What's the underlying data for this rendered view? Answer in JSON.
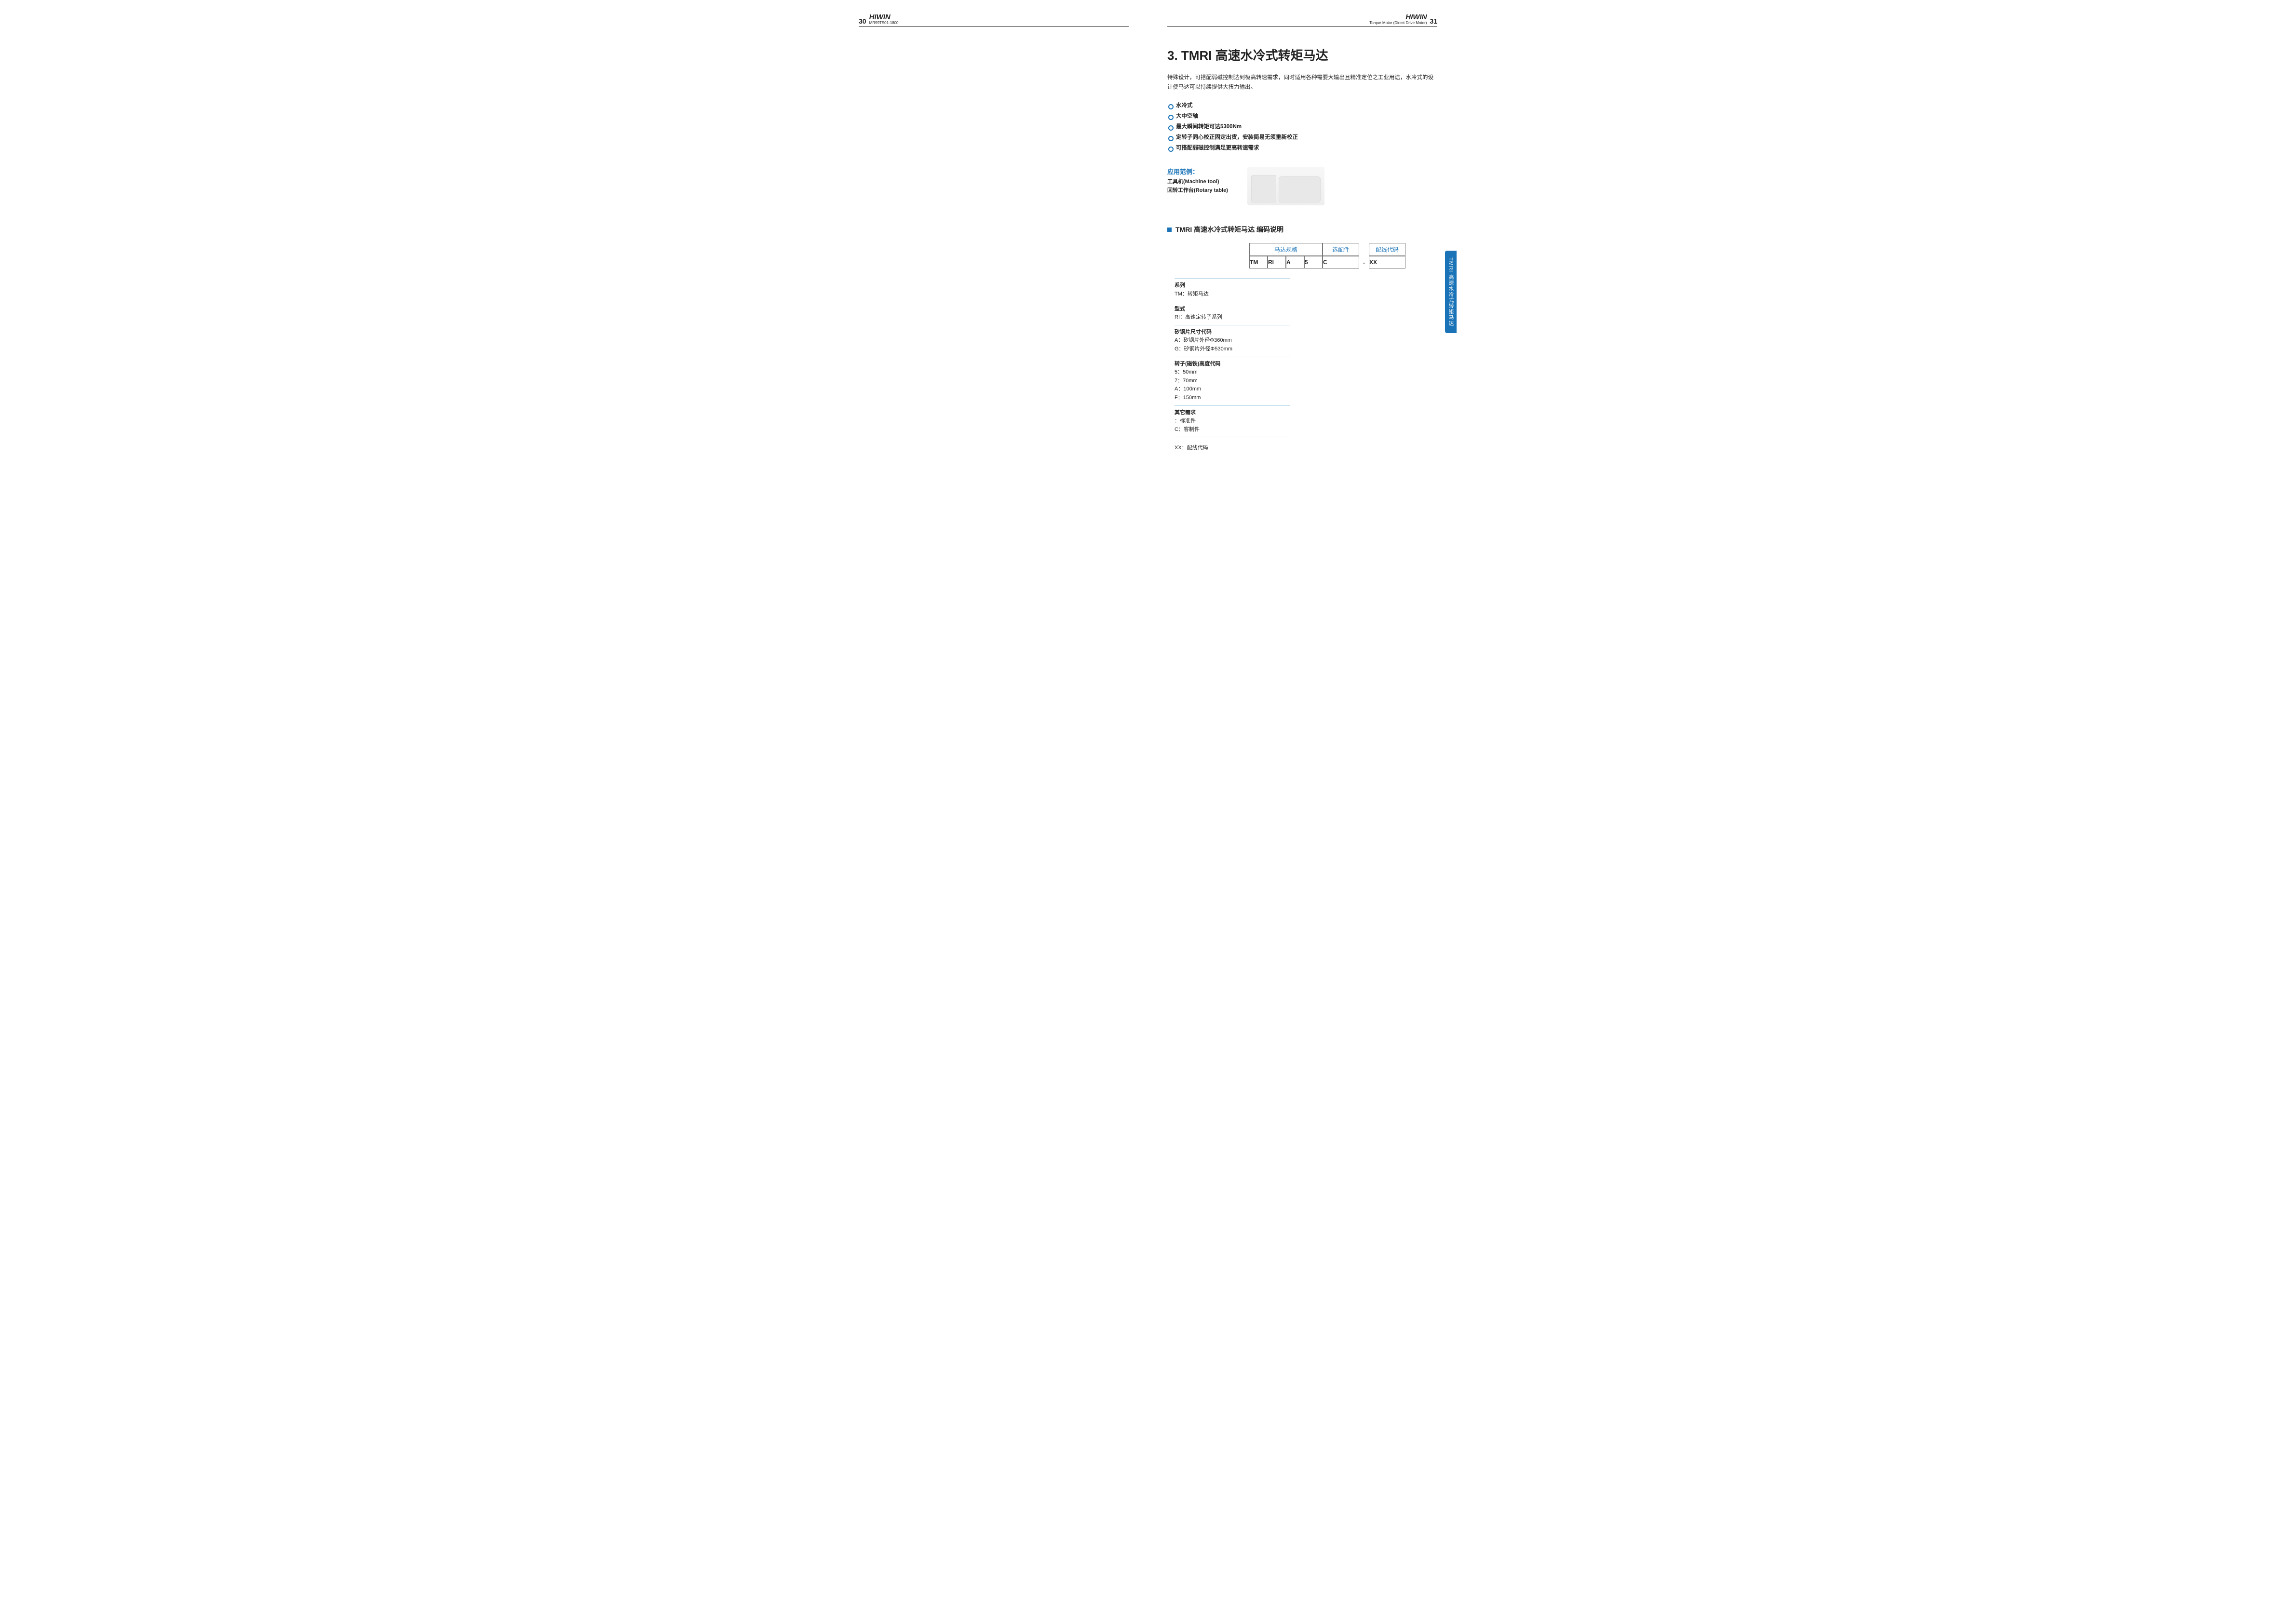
{
  "header": {
    "left": {
      "page": "30",
      "brand": "HIWIN",
      "doccode": "MR99TS01-1800"
    },
    "right": {
      "brand": "HIWIN",
      "subtitle": "Torque Motor (Direct Drive Motor)",
      "page": "31"
    }
  },
  "title": "3. TMRI 高速水冷式转矩马达",
  "intro": "特殊设计，可搭配弱磁控制达到极高转速需求，同时适用各种需要大输出且精准定位之工业用途，水冷式的设计使马达可以持续提供大扭力输出。",
  "features": [
    "水冷式",
    "大中空轴",
    "最大瞬间转矩可达5300Nm",
    "定转子同心校正固定出货，安装简易无须重新校正",
    "可搭配弱磁控制满足更高转速需求"
  ],
  "application": {
    "title": "应用范例：",
    "lines": [
      "工具机(Machine tool)",
      "回转工作台(Rotary table)"
    ]
  },
  "encodingHeading": "TMRI 高速水冷式转矩马达 编码说明",
  "codeTable": {
    "groups": {
      "motor": {
        "head": "马达规格",
        "cells": [
          "TM",
          "RI",
          "A",
          "5"
        ]
      },
      "option": {
        "head": "选配件",
        "cells": [
          "C"
        ]
      },
      "dash": "-",
      "wiring": {
        "head": "配线代码",
        "cells": [
          "XX"
        ]
      }
    }
  },
  "descriptors": [
    {
      "label": "系列",
      "lines": [
        "TM：转矩马达"
      ]
    },
    {
      "label": "型式",
      "lines": [
        "RI：高速定转子系列"
      ]
    },
    {
      "label": "矽钢片尺寸代码",
      "lines": [
        "A：矽钢片外径Φ360mm",
        "G：矽钢片外径Φ530mm"
      ]
    },
    {
      "label": "转子(磁铁)高度代码",
      "lines": [
        "5：50mm",
        "7：70mm",
        "A：100mm",
        "F：150mm"
      ]
    },
    {
      "label": "其它需求",
      "lines": [
        "：标准件",
        "C：客制件"
      ]
    },
    {
      "label": "",
      "lines": [
        "XX：配线代码"
      ],
      "noborder": true
    }
  ],
  "sideTab": "TMRI 高速水冷式转矩马达"
}
